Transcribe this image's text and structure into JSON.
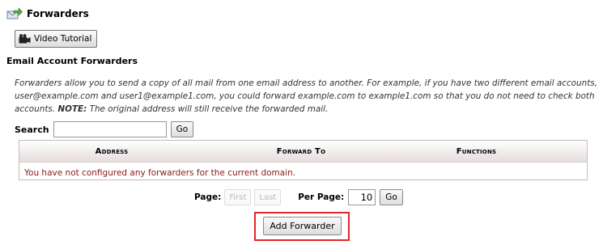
{
  "header": {
    "title": "Forwarders",
    "icon": "forward-mail-icon"
  },
  "video_tutorial": {
    "label": "Video Tutorial",
    "icon": "film-camera-icon"
  },
  "section": {
    "title": "Email Account Forwarders",
    "description_main": "Forwarders allow you to send a copy of all mail from one email address to another. For example, if you have two different email accounts, user@example.com and user1@example1.com, you could forward example.com to example1.com so that you do not need to check both accounts. ",
    "description_note_label": "NOTE:",
    "description_note_text": " The original address will still receive the forwarded mail."
  },
  "search": {
    "label": "Search",
    "value": "",
    "go_label": "Go"
  },
  "table": {
    "columns": [
      "Address",
      "Forward To",
      "Functions"
    ],
    "empty_message": "You have not configured any forwarders for the current domain."
  },
  "pagination": {
    "page_label": "Page:",
    "first_label": "First",
    "last_label": "Last",
    "per_page_label": "Per Page:",
    "per_page_value": "10",
    "go_label": "Go"
  },
  "actions": {
    "add_forwarder_label": "Add Forwarder"
  },
  "colors": {
    "highlight": "#e2262a",
    "message": "#8b1a1a"
  }
}
